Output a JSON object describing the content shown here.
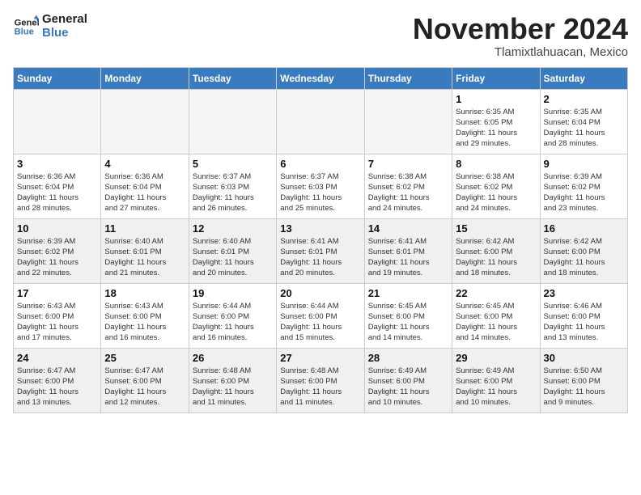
{
  "header": {
    "logo_line1": "General",
    "logo_line2": "Blue",
    "month": "November 2024",
    "location": "Tlamixtlahuacan, Mexico"
  },
  "weekdays": [
    "Sunday",
    "Monday",
    "Tuesday",
    "Wednesday",
    "Thursday",
    "Friday",
    "Saturday"
  ],
  "weeks": [
    [
      {
        "day": "",
        "info": "",
        "empty": true
      },
      {
        "day": "",
        "info": "",
        "empty": true
      },
      {
        "day": "",
        "info": "",
        "empty": true
      },
      {
        "day": "",
        "info": "",
        "empty": true
      },
      {
        "day": "",
        "info": "",
        "empty": true
      },
      {
        "day": "1",
        "info": "Sunrise: 6:35 AM\nSunset: 6:05 PM\nDaylight: 11 hours\nand 29 minutes.",
        "empty": false
      },
      {
        "day": "2",
        "info": "Sunrise: 6:35 AM\nSunset: 6:04 PM\nDaylight: 11 hours\nand 28 minutes.",
        "empty": false
      }
    ],
    [
      {
        "day": "3",
        "info": "Sunrise: 6:36 AM\nSunset: 6:04 PM\nDaylight: 11 hours\nand 28 minutes.",
        "empty": false
      },
      {
        "day": "4",
        "info": "Sunrise: 6:36 AM\nSunset: 6:04 PM\nDaylight: 11 hours\nand 27 minutes.",
        "empty": false
      },
      {
        "day": "5",
        "info": "Sunrise: 6:37 AM\nSunset: 6:03 PM\nDaylight: 11 hours\nand 26 minutes.",
        "empty": false
      },
      {
        "day": "6",
        "info": "Sunrise: 6:37 AM\nSunset: 6:03 PM\nDaylight: 11 hours\nand 25 minutes.",
        "empty": false
      },
      {
        "day": "7",
        "info": "Sunrise: 6:38 AM\nSunset: 6:02 PM\nDaylight: 11 hours\nand 24 minutes.",
        "empty": false
      },
      {
        "day": "8",
        "info": "Sunrise: 6:38 AM\nSunset: 6:02 PM\nDaylight: 11 hours\nand 24 minutes.",
        "empty": false
      },
      {
        "day": "9",
        "info": "Sunrise: 6:39 AM\nSunset: 6:02 PM\nDaylight: 11 hours\nand 23 minutes.",
        "empty": false
      }
    ],
    [
      {
        "day": "10",
        "info": "Sunrise: 6:39 AM\nSunset: 6:02 PM\nDaylight: 11 hours\nand 22 minutes.",
        "empty": false
      },
      {
        "day": "11",
        "info": "Sunrise: 6:40 AM\nSunset: 6:01 PM\nDaylight: 11 hours\nand 21 minutes.",
        "empty": false
      },
      {
        "day": "12",
        "info": "Sunrise: 6:40 AM\nSunset: 6:01 PM\nDaylight: 11 hours\nand 20 minutes.",
        "empty": false
      },
      {
        "day": "13",
        "info": "Sunrise: 6:41 AM\nSunset: 6:01 PM\nDaylight: 11 hours\nand 20 minutes.",
        "empty": false
      },
      {
        "day": "14",
        "info": "Sunrise: 6:41 AM\nSunset: 6:01 PM\nDaylight: 11 hours\nand 19 minutes.",
        "empty": false
      },
      {
        "day": "15",
        "info": "Sunrise: 6:42 AM\nSunset: 6:00 PM\nDaylight: 11 hours\nand 18 minutes.",
        "empty": false
      },
      {
        "day": "16",
        "info": "Sunrise: 6:42 AM\nSunset: 6:00 PM\nDaylight: 11 hours\nand 18 minutes.",
        "empty": false
      }
    ],
    [
      {
        "day": "17",
        "info": "Sunrise: 6:43 AM\nSunset: 6:00 PM\nDaylight: 11 hours\nand 17 minutes.",
        "empty": false
      },
      {
        "day": "18",
        "info": "Sunrise: 6:43 AM\nSunset: 6:00 PM\nDaylight: 11 hours\nand 16 minutes.",
        "empty": false
      },
      {
        "day": "19",
        "info": "Sunrise: 6:44 AM\nSunset: 6:00 PM\nDaylight: 11 hours\nand 16 minutes.",
        "empty": false
      },
      {
        "day": "20",
        "info": "Sunrise: 6:44 AM\nSunset: 6:00 PM\nDaylight: 11 hours\nand 15 minutes.",
        "empty": false
      },
      {
        "day": "21",
        "info": "Sunrise: 6:45 AM\nSunset: 6:00 PM\nDaylight: 11 hours\nand 14 minutes.",
        "empty": false
      },
      {
        "day": "22",
        "info": "Sunrise: 6:45 AM\nSunset: 6:00 PM\nDaylight: 11 hours\nand 14 minutes.",
        "empty": false
      },
      {
        "day": "23",
        "info": "Sunrise: 6:46 AM\nSunset: 6:00 PM\nDaylight: 11 hours\nand 13 minutes.",
        "empty": false
      }
    ],
    [
      {
        "day": "24",
        "info": "Sunrise: 6:47 AM\nSunset: 6:00 PM\nDaylight: 11 hours\nand 13 minutes.",
        "empty": false
      },
      {
        "day": "25",
        "info": "Sunrise: 6:47 AM\nSunset: 6:00 PM\nDaylight: 11 hours\nand 12 minutes.",
        "empty": false
      },
      {
        "day": "26",
        "info": "Sunrise: 6:48 AM\nSunset: 6:00 PM\nDaylight: 11 hours\nand 11 minutes.",
        "empty": false
      },
      {
        "day": "27",
        "info": "Sunrise: 6:48 AM\nSunset: 6:00 PM\nDaylight: 11 hours\nand 11 minutes.",
        "empty": false
      },
      {
        "day": "28",
        "info": "Sunrise: 6:49 AM\nSunset: 6:00 PM\nDaylight: 11 hours\nand 10 minutes.",
        "empty": false
      },
      {
        "day": "29",
        "info": "Sunrise: 6:49 AM\nSunset: 6:00 PM\nDaylight: 11 hours\nand 10 minutes.",
        "empty": false
      },
      {
        "day": "30",
        "info": "Sunrise: 6:50 AM\nSunset: 6:00 PM\nDaylight: 11 hours\nand 9 minutes.",
        "empty": false
      }
    ]
  ]
}
